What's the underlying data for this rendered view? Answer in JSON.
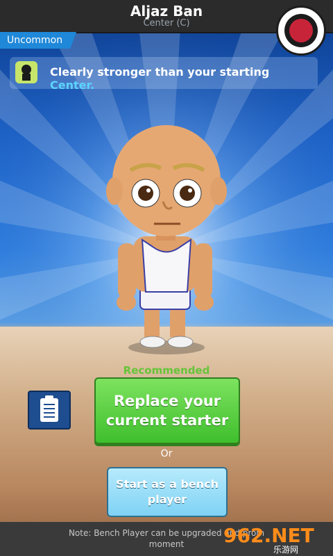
{
  "header": {
    "player_name": "Aljaz Ban",
    "position": "Center (C)",
    "rarity": "Uncommon"
  },
  "info": {
    "text_prefix": "Clearly stronger than your starting ",
    "text_highlight": "Center."
  },
  "actions": {
    "recommended_label": "Recommended",
    "replace_line1": "Replace your",
    "replace_line2": "current starter",
    "or_label": "Or",
    "bench_line1": "Start as a bench",
    "bench_line2": "player"
  },
  "note": {
    "line1": "Note: Bench Player can be upgraded and prom",
    "line2": "moment"
  },
  "watermark": {
    "main": "962.NET",
    "sub": "乐游网"
  },
  "colors": {
    "accent_green": "#66c43a",
    "highlight_blue": "#5bd3ff",
    "rarity_blue": "#1f88d8"
  },
  "icons": [
    "team-logo-icon",
    "skill-icon",
    "clipboard-icon"
  ]
}
